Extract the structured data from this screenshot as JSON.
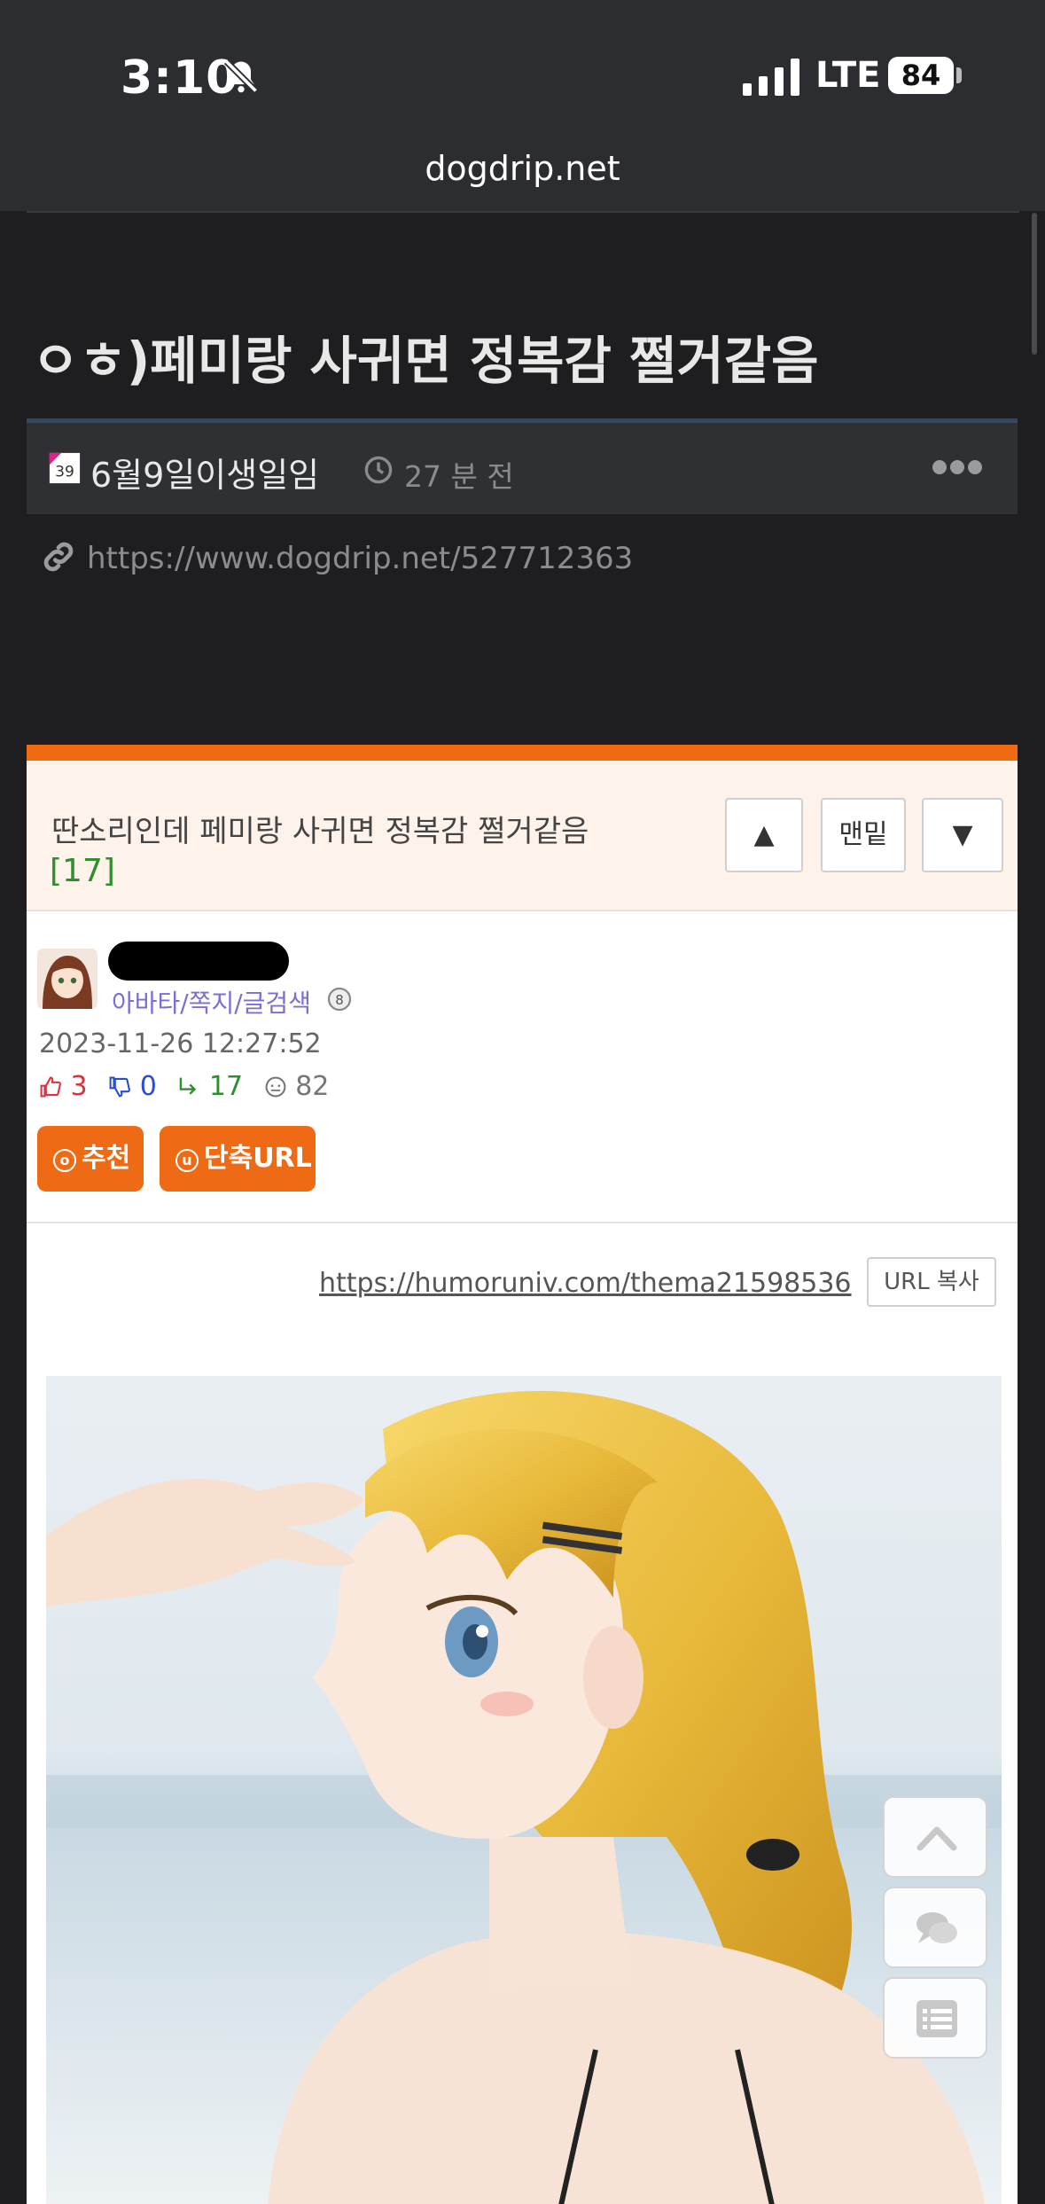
{
  "status_bar": {
    "time": "3:10",
    "network": "LTE",
    "battery": "84"
  },
  "browser": {
    "domain": "dogdrip.net"
  },
  "post": {
    "title": "ㅇㅎ)페미랑 사귀면 정복감 쩔거같음",
    "author": "6월9일이생일임",
    "time_ago": "27 분 전",
    "url": "https://www.dogdrip.net/527712363"
  },
  "embed": {
    "title": "딴소리인데 페미랑 사귀면 정복감 쩔거같음",
    "comment_count": "[17]",
    "nav": {
      "up": "▲",
      "bottom": "맨밑",
      "down": "▼"
    },
    "profile_links": "아바타/쪽지/글검색",
    "date": "2023-11-26 12:27:52",
    "stats": {
      "likes": "3",
      "dislikes": "0",
      "replies": "17",
      "views": "82"
    },
    "recommend_label": "추천",
    "short_url_label": "단축URL",
    "source_url": "https://humoruniv.com/thema21598536",
    "copy_label": "URL 복사"
  },
  "icons": [
    "bell-slash-icon",
    "signal-icon",
    "battery-icon",
    "calendar-icon",
    "clock-icon",
    "more-icon",
    "link-icon",
    "thumbs-up-icon",
    "thumbs-down-icon",
    "reply-icon",
    "eye-icon",
    "chevron-up-icon",
    "chat-icon",
    "list-icon"
  ]
}
